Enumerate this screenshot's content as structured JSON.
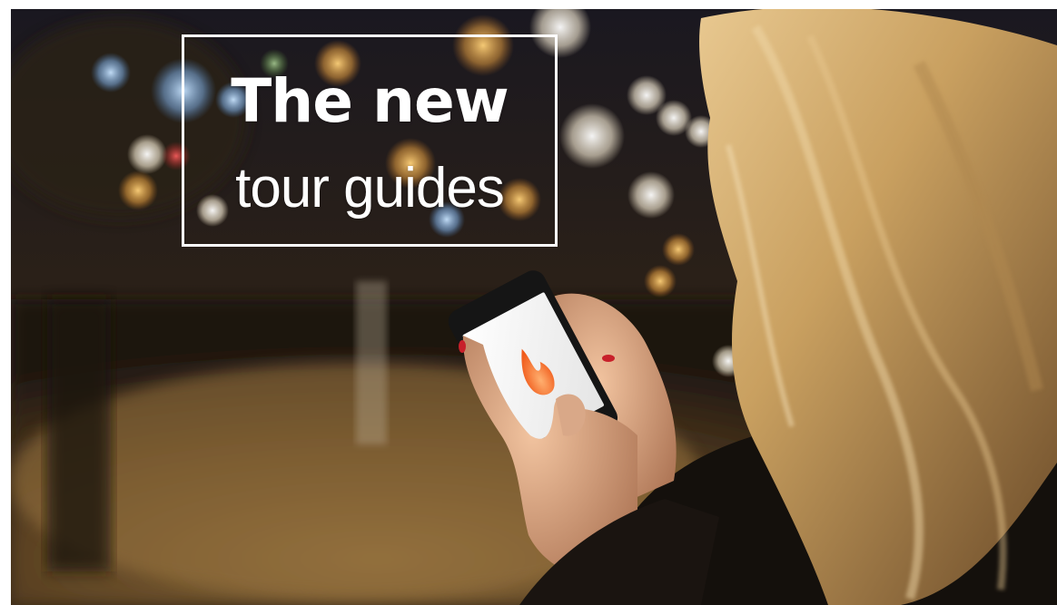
{
  "headline": {
    "line1": "The new",
    "line2": "tour guides"
  },
  "photo": {
    "subject": "woman-using-smartphone-at-night",
    "app_icon": "flame-icon",
    "colors": {
      "night_bg": "#1a1410",
      "warm_glow": "#d9a04a",
      "hair": "#c9a060",
      "flame": "#f07a2a",
      "screen": "#f2f2f2"
    }
  }
}
